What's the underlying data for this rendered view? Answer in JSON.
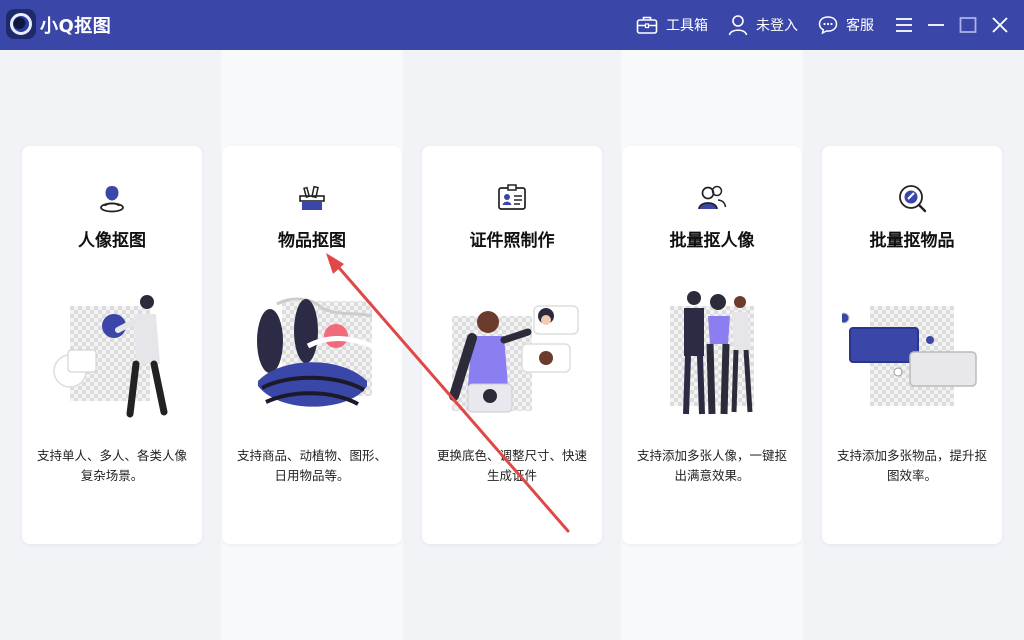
{
  "app": {
    "title": "小Q抠图"
  },
  "toolbar": {
    "toolbox": {
      "label": "工具箱",
      "icon": "toolbox-icon"
    },
    "login": {
      "label": "未登入",
      "icon": "user-icon"
    },
    "service": {
      "label": "客服",
      "icon": "chat-icon"
    }
  },
  "cards": [
    {
      "title": "人像抠图",
      "desc": "支持单人、多人、各类人像复杂场景。",
      "icon": "portrait-icon"
    },
    {
      "title": "物品抠图",
      "desc": "支持商品、动植物、图形、日用物品等。",
      "icon": "basket-icon"
    },
    {
      "title": "证件照制作",
      "desc": "更换底色、调整尺寸、快速生成证件",
      "icon": "id-card-icon"
    },
    {
      "title": "批量抠人像",
      "desc": "支持添加多张人像，一键抠出满意效果。",
      "icon": "group-icon"
    },
    {
      "title": "批量抠物品",
      "desc": "支持添加多张物品，提升抠图效率。",
      "icon": "object-search-icon"
    }
  ],
  "colors": {
    "titlebar": "#3b47a8",
    "accent": "#3b47a8",
    "annotation_arrow": "#e04848"
  }
}
